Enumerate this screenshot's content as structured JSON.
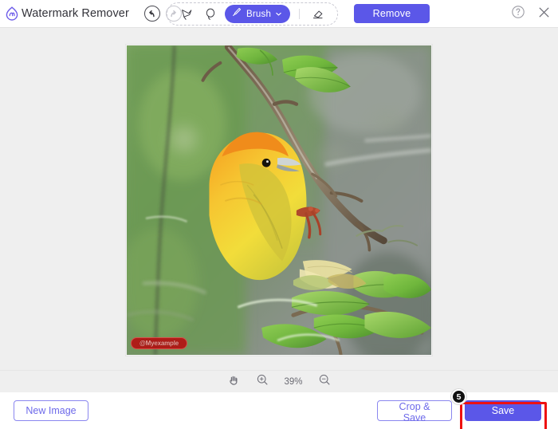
{
  "app": {
    "title": "Watermark Remover",
    "logo_icon": "droplet-logo-icon",
    "accent_color": "#5b57e8",
    "highlight_color": "#ee1111"
  },
  "header": {
    "undo_icon": "undo-arrow-icon",
    "redo_icon": "redo-arrow-icon",
    "tools": [
      {
        "name": "polygon-lasso-tool",
        "icon": "polygon-lasso-icon",
        "label": ""
      },
      {
        "name": "lasso-tool",
        "icon": "lasso-icon",
        "label": ""
      },
      {
        "name": "brush-tool",
        "icon": "brush-icon",
        "label": "Brush",
        "chevron": "chevron-down-icon",
        "active": true
      },
      {
        "name": "eraser-tool",
        "icon": "eraser-icon",
        "label": ""
      }
    ],
    "remove_label": "Remove",
    "help_icon": "question-mark-icon",
    "close_icon": "close-x-icon"
  },
  "canvas": {
    "image_alt": "yellow weaver bird perched on a branch with green leaves",
    "watermark_text": "@Myexample"
  },
  "zoombar": {
    "hand_icon": "hand-pan-icon",
    "zoom_in_icon": "zoom-in-icon",
    "zoom_out_icon": "zoom-out-icon",
    "zoom_level": "39%"
  },
  "footer": {
    "new_image_label": "New Image",
    "crop_save_label": "Crop & Save",
    "save_label": "Save",
    "step_badge": "5"
  }
}
